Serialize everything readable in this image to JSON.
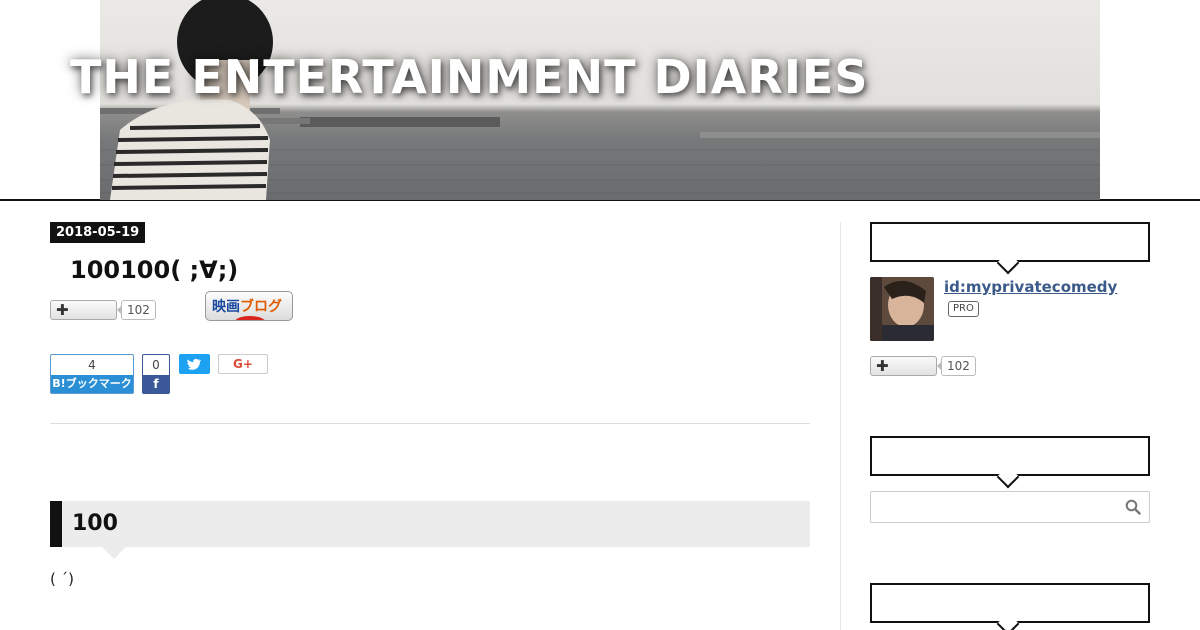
{
  "header": {
    "blog_title": "THE ENTERTAINMENT DIARIES"
  },
  "entry": {
    "date": "2018-05-19",
    "title": "100100( ;∀;)",
    "subscribe_count": "102",
    "movie_blog_banner": {
      "part1": "映画",
      "part2": "ブログ"
    },
    "share": {
      "hatena_count": "4",
      "hatena_label": "B!ブックマーク",
      "facebook_count": "0",
      "facebook_label": "f",
      "google_plus_label": "G+"
    },
    "section_heading": "100",
    "body_text": "( ´)"
  },
  "sidebar": {
    "profile": {
      "id": "id:myprivatecomedy",
      "badge": "PRO",
      "subscribe_count": "102"
    },
    "search": {
      "placeholder": "",
      "value": ""
    }
  },
  "colors": {
    "accent_dark": "#111111",
    "hatena_blue": "#2a8fd4",
    "facebook_blue": "#3b5998",
    "twitter_blue": "#1da1f2",
    "google_red": "#dd4b39",
    "profile_link": "#3b5a8a"
  },
  "icons": {
    "subscribe": "plus-icon",
    "search": "magnifier-icon",
    "twitter": "twitter-bird-icon",
    "facebook": "facebook-f-icon"
  }
}
